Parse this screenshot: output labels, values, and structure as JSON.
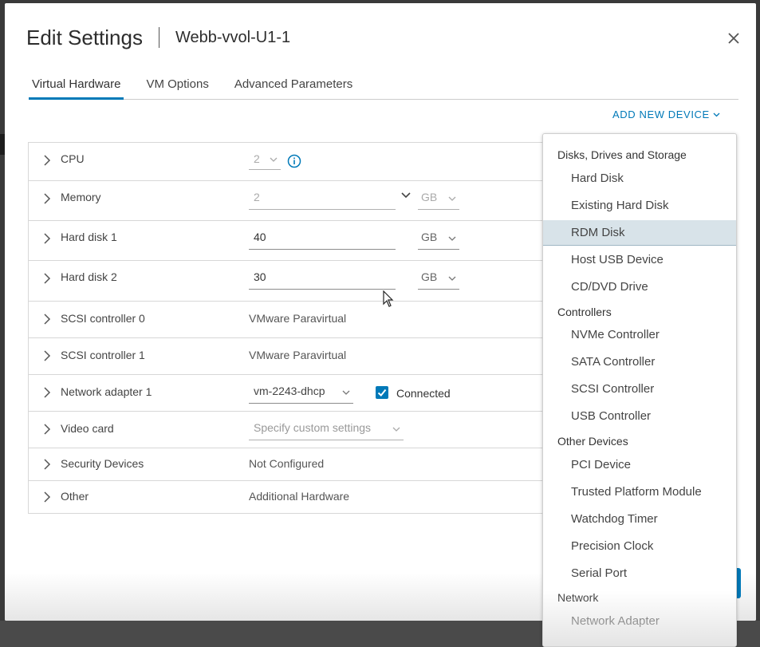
{
  "dialog": {
    "title": "Edit Settings",
    "vm_name": "Webb-vvol-U1-1"
  },
  "tabs": [
    {
      "label": "Virtual Hardware",
      "active": true
    },
    {
      "label": "VM Options",
      "active": false
    },
    {
      "label": "Advanced Parameters",
      "active": false
    }
  ],
  "add_new_device": "ADD NEW DEVICE",
  "hardware": {
    "cpu": {
      "label": "CPU",
      "value": "2"
    },
    "memory": {
      "label": "Memory",
      "value": "2",
      "unit": "GB"
    },
    "hard_disk_1": {
      "label": "Hard disk 1",
      "value": "40",
      "unit": "GB"
    },
    "hard_disk_2": {
      "label": "Hard disk 2",
      "value": "30",
      "unit": "GB"
    },
    "scsi_0": {
      "label": "SCSI controller 0",
      "value": "VMware Paravirtual"
    },
    "scsi_1": {
      "label": "SCSI controller 1",
      "value": "VMware Paravirtual"
    },
    "network_1": {
      "label": "Network adapter 1",
      "value": "vm-2243-dhcp",
      "connected_label": "Connected",
      "connected": true
    },
    "video_card": {
      "label": "Video card",
      "value": "Specify custom settings"
    },
    "security": {
      "label": "Security Devices",
      "value": "Not Configured"
    },
    "other": {
      "label": "Other",
      "value": "Additional Hardware"
    }
  },
  "device_menu": {
    "groups": [
      {
        "name": "Disks, Drives and Storage",
        "items": [
          "Hard Disk",
          "Existing Hard Disk",
          "RDM Disk",
          "Host USB Device",
          "CD/DVD Drive"
        ]
      },
      {
        "name": "Controllers",
        "items": [
          "NVMe Controller",
          "SATA Controller",
          "SCSI Controller",
          "USB Controller"
        ]
      },
      {
        "name": "Other Devices",
        "items": [
          "PCI Device",
          "Trusted Platform Module",
          "Watchdog Timer",
          "Precision Clock",
          "Serial Port"
        ]
      },
      {
        "name": "Network",
        "items": [
          "Network Adapter"
        ]
      }
    ],
    "highlighted": "RDM Disk"
  },
  "colors": {
    "accent": "#0079b8",
    "hover_bg": "#d8e3e9"
  },
  "icons": {
    "close": "close-icon",
    "info": "info-icon",
    "chevron": "chevron-right-icon",
    "select": "chevron-down-icon",
    "check": "checkmark-icon"
  }
}
